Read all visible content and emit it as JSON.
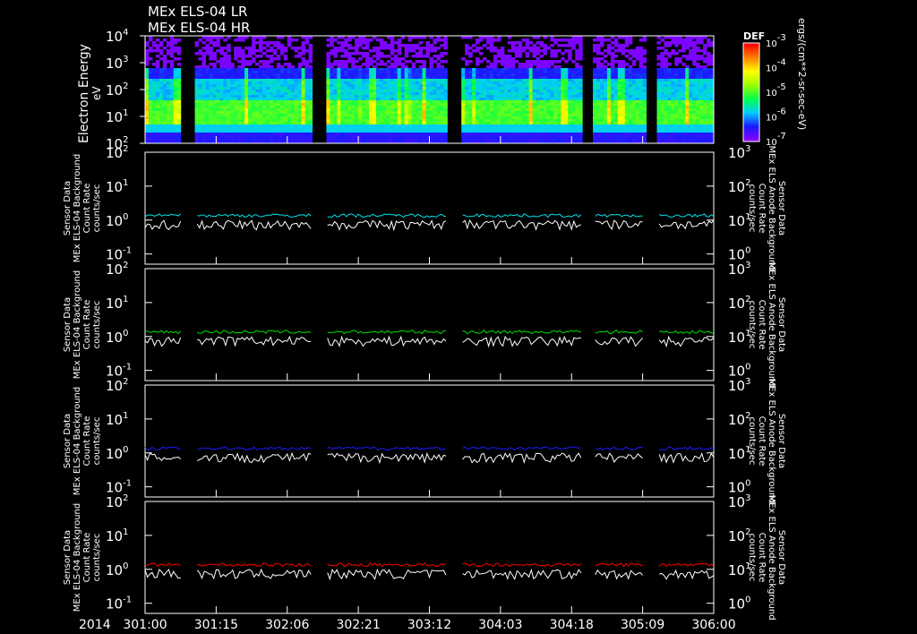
{
  "chart_data": {
    "type": "spectrogram+line",
    "titles": [
      "MEx ELS-04 LR",
      "MEx ELS-04 HR"
    ],
    "x_range_hours": [
      0,
      120
    ],
    "x_ticks": [
      "301:00",
      "301:15",
      "302:06",
      "302:21",
      "303:12",
      "304:03",
      "304:18",
      "305:09",
      "306:00"
    ],
    "x_year": "2014",
    "data_gaps_hours": [
      [
        7.7,
        10.6
      ],
      [
        35.5,
        38.4
      ],
      [
        63.9,
        66.7
      ],
      [
        92.2,
        94.5
      ],
      [
        105.5,
        108.3
      ]
    ],
    "spectrogram": {
      "ylabel": "Electron Energy",
      "yunit": "eV",
      "yticks": [
        "10",
        "10",
        "10",
        "10",
        "10"
      ],
      "yexp": [
        "2",
        "1",
        "2",
        "3",
        "4"
      ],
      "ylim": [
        1,
        10000
      ],
      "colorbar_title": "DEF",
      "colorbar_unit": "ergs/(cm**2-sr-sec-eV)",
      "colorbar_ticks": [
        "10",
        "10",
        "10",
        "10",
        "10"
      ],
      "colorbar_exp": [
        "-3",
        "-4",
        "-5",
        "-6",
        "-7"
      ],
      "colorbar_range": [
        1e-07,
        0.001
      ]
    },
    "line_panels": [
      {
        "left_label": [
          "Sensor Data",
          "MEx ELS-04 Background",
          "Count Rate",
          "counts/sec"
        ],
        "right_label": [
          "Sensor Data",
          "MEx ELS Anode Background",
          "Count Rate",
          "counts/sec"
        ],
        "color": "#00e5ee",
        "background_level": 0.6,
        "anode_level_right_axis": 10
      },
      {
        "left_label": [
          "Sensor Data",
          "MEx ELS-04 Background",
          "Count Rate",
          "counts/sec"
        ],
        "right_label": [
          "Sensor Data",
          "MEx ELS Anode Background",
          "Count Rate",
          "counts/sec"
        ],
        "color": "#00e000",
        "background_level": 0.6,
        "anode_level_right_axis": 10
      },
      {
        "left_label": [
          "Sensor Data",
          "MEx ELS-04 Background",
          "Count Rate",
          "counts/sec"
        ],
        "right_label": [
          "Sensor Data",
          "MEx ELS Anode Background",
          "Count Rate",
          "counts/sec"
        ],
        "color": "#1a1aff",
        "background_level": 0.6,
        "anode_level_right_axis": 10
      },
      {
        "left_label": [
          "Sensor Data",
          "MEx ELS-04 Background",
          "Count Rate",
          "counts/sec"
        ],
        "right_label": [
          "Sensor Data",
          "MEx ELS Anode Background",
          "Count Rate",
          "counts/sec"
        ],
        "color": "#ff0000",
        "background_level": 0.6,
        "anode_level_right_axis": 10
      }
    ],
    "left_yticks": [
      "10",
      "10",
      "10",
      "10"
    ],
    "left_yexp": [
      "2",
      "1",
      "0",
      "-1"
    ],
    "left_ylim": [
      0.03,
      100
    ],
    "right_yticks": [
      "10",
      "10",
      "10",
      "10"
    ],
    "right_yexp": [
      "3",
      "2",
      "1",
      "0"
    ],
    "right_ylim": [
      0.3,
      1000
    ]
  }
}
